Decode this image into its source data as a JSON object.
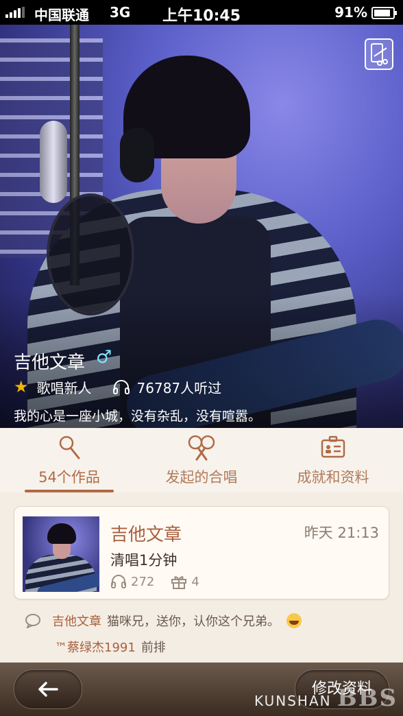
{
  "status_bar": {
    "carrier": "中国联通",
    "network": "3G",
    "time": "上午10:45",
    "battery_percent": "91%"
  },
  "profile": {
    "name": "吉他文章",
    "gender_symbol": "♂",
    "level": "歌唱新人",
    "listen_count": "76787人听过",
    "signature": "我的心是一座小城，没有杂乱，没有喧嚣。"
  },
  "tabs": [
    {
      "label": "54个作品",
      "icon": "microphone-icon",
      "active": true
    },
    {
      "label": "发起的合唱",
      "icon": "duet-microphones-icon",
      "active": false
    },
    {
      "label": "成就和资料",
      "icon": "id-card-icon",
      "active": false
    }
  ],
  "post": {
    "author": "吉他文章",
    "time": "昨天 21:13",
    "title": "清唱1分钟",
    "plays": "272",
    "gifts": "4"
  },
  "comments": [
    {
      "name": "吉他文章",
      "text": "猫咪兄，送你，认你这个兄弟。"
    },
    {
      "name": "™蔡绿杰1991",
      "text": "前排"
    }
  ],
  "bottom_bar": {
    "edit_label": "修改资料"
  },
  "watermark": {
    "text": "KUNSHAN",
    "big": "BBS"
  },
  "colors": {
    "accent": "#b06a45",
    "tab_text": "#b07a5a",
    "page_bg": "#f4ede4"
  }
}
